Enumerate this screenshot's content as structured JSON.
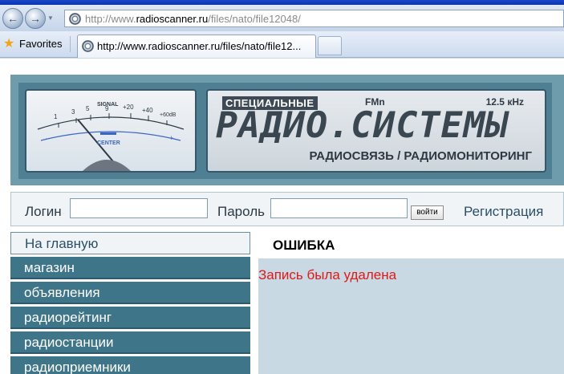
{
  "browser": {
    "address": {
      "prefix": "http://www.",
      "host": "radioscanner.ru",
      "path": "/files/nato/file12048/"
    },
    "favorites_label": "Favorites",
    "tab_title": "http://www.radioscanner.ru/files/nato/file12..."
  },
  "banner": {
    "meter": {
      "label_signal": "SIGNAL",
      "label_center": "CENTER",
      "scale_labels": [
        "1",
        "3",
        "5",
        "9",
        "+20",
        "+40",
        "+60dB"
      ]
    },
    "badge": "СПЕЦИАЛЬНЫЕ",
    "fm": "FMn",
    "freq": "12.5 кHz",
    "title": "РАДИО.СИСТЕМЫ",
    "subtitle": "РАДИОСВЯЗЬ / РАДИОМОНИТОРИНГ"
  },
  "login": {
    "login_label": "Логин",
    "password_label": "Пароль",
    "login_value": "",
    "password_value": "",
    "submit_label": "войти",
    "register_label": "Регистрация"
  },
  "menu": {
    "items": [
      {
        "label": "На главную"
      },
      {
        "label": "магазин"
      },
      {
        "label": "объявления"
      },
      {
        "label": "радиорейтинг"
      },
      {
        "label": "радиостанции"
      },
      {
        "label": "радиоприемники"
      }
    ]
  },
  "content": {
    "title": "ОШИБКА",
    "message": "Запись была удалена"
  }
}
